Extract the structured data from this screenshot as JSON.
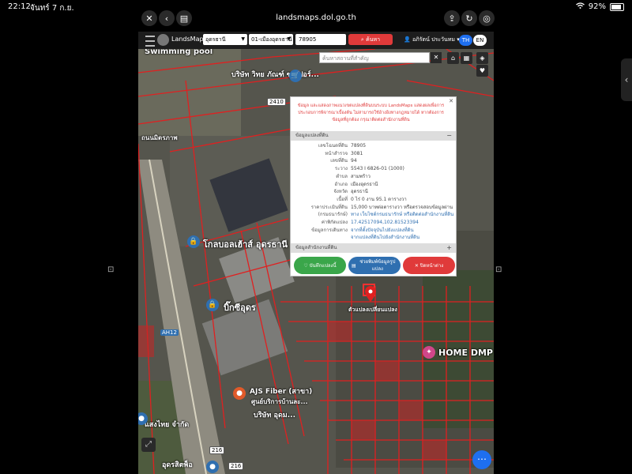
{
  "status_bar": {
    "time": "22:12",
    "date": "จันทร์ 7 ก.ย.",
    "battery": "92%",
    "battery_level": 0.92
  },
  "browser": {
    "url": "landsmaps.dol.go.th"
  },
  "app": {
    "name": "LandsMaps",
    "province_select": "อุดรธานี",
    "district_select": "01-เมืองอุดรธานี",
    "parcel_input": "78905",
    "search_label": "ค้นหา",
    "user_name": "อภิรัตน์ ประวันทม",
    "lang_th": "TH",
    "lang_en": "EN"
  },
  "map": {
    "place_search_placeholder": "ค้นหาสถานที่สำคัญ",
    "labels": {
      "swimming_pool": "Swimming pool",
      "company_top": "บริษัท วิทย ภัณฑ์ ซุปเปอร์...",
      "road_left": "ถนนมิตรภาพ",
      "globalhouse": "โกลบอลเฮ้าส์ อุดรธานี",
      "big_c": "บิ๊กซีอุดร",
      "home_dmp": "HOME DMP",
      "ajs": "AJS Fiber (สาขา)",
      "ajs_sub": "ศูนย์บริการบ้านละ...",
      "company_bottom": "บริษัท อุดม...",
      "sangthai": "แสงไทย จำกัด",
      "udon_bottom": "อุดรสิตพ็อ",
      "parcel_pin_label": "ตัวแปลงเปลี่ยนแปลง",
      "road_2410": "2410",
      "road_ah12": "AH12",
      "road_216a": "216",
      "road_216b": "216"
    }
  },
  "popup": {
    "warning": "ข้อมูล และแสดงภาพแนวเขตแปลงที่ดินบนระบบ LandsMaps แสดงผลเพื่อการประกอบการพิจารณาเบื้องต้น ไม่สามารถใช้อ้างอิงทางกฎหมายได้ หากต้องการข้อมูลที่ถูกต้อง กรุณาติดต่อสำนักงานที่ดิน",
    "section_parcel": "ข้อมูลแปลงที่ดิน",
    "rows": [
      {
        "k": "เลขโฉนดที่ดิน",
        "v": "78905"
      },
      {
        "k": "หน้าสำรวจ",
        "v": "3081"
      },
      {
        "k": "เลขที่ดิน",
        "v": "94"
      },
      {
        "k": "ระวาง",
        "v": "5543 I 6826-01 (1000)"
      },
      {
        "k": "ตำบล",
        "v": "สามพร้าว"
      },
      {
        "k": "อำเภอ",
        "v": "เมืองอุดรธานี"
      },
      {
        "k": "จังหวัด",
        "v": "อุดรธานี"
      },
      {
        "k": "เนื้อที่",
        "v": "0 ไร่ 0 งาน 95.1 ตารางวา"
      },
      {
        "k": "ราคาประเมินที่ดิน",
        "v": "15,000 บาทต่อตารางวา หรือตรวจสอบข้อมูลผ่าน"
      },
      {
        "k": "(กรมธนารักษ์)",
        "v": "ทาง เว็บไซต์กรมธนารักษ์ หรือติดต่อสำนักงานที่ดิน"
      },
      {
        "k": "ค่าพิกัดแปลง",
        "v": "17.42517094,102.81523394"
      },
      {
        "k": "ข้อมูลการเดินทาง",
        "v": "จากที่ตั้งปัจจุบันไปยังแปลงที่ดิน"
      },
      {
        "k": "",
        "v": "จากแปลงที่ดินไปยังสำนักงานที่ดิน"
      }
    ],
    "section_office": "ข้อมูลสำนักงานที่ดิน",
    "btn_save": "บันทึกแปลงนี้",
    "btn_print": "ช่วยพิมพ์ข้อมูลรูปแปลง",
    "btn_close": "ปิดหน้าต่าง"
  },
  "colors": {
    "accent_red": "#e03a3a",
    "accent_blue": "#2f6fb0",
    "accent_green": "#3aa64a",
    "parcel_line": "#e02020"
  }
}
